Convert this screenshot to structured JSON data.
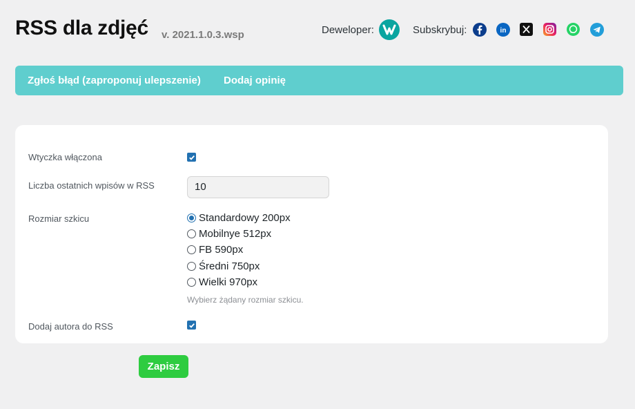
{
  "header": {
    "title": "RSS dla zdjęć",
    "version": "v. 2021.1.0.3.wsp",
    "developer_label": "Deweloper:",
    "subscribe_label": "Subskrybuj:",
    "social_icons": [
      "facebook-icon",
      "linkedin-icon",
      "x-icon",
      "instagram-icon",
      "whatsapp-icon",
      "telegram-icon"
    ]
  },
  "nav": {
    "report_bug": "Zgłoś błąd (zaproponuj ulepszenie)",
    "add_review": "Dodaj opinię"
  },
  "form": {
    "enabled_label": "Wtyczka włączona",
    "enabled_checked": true,
    "count_label": "Liczba ostatnich wpisów w RSS",
    "count_value": "10",
    "size_label": "Rozmiar szkicu",
    "size_options": [
      "Standardowy 200px",
      "Mobilnye 512px",
      "FB 590px",
      "Średni 750px",
      "Wielki 970px"
    ],
    "size_selected": "Standardowy 200px",
    "size_hint": "Wybierz żądany rozmiar szkicu.",
    "author_label": "Dodaj autora do RSS",
    "author_checked": true
  },
  "actions": {
    "save_label": "Zapisz"
  },
  "colors": {
    "nav_bg": "#5fcece",
    "save_bg": "#2ecc40",
    "accent": "#2271b1"
  }
}
